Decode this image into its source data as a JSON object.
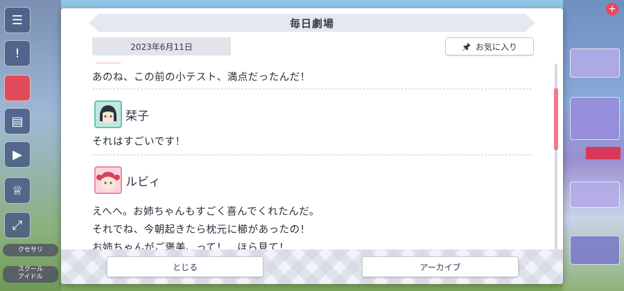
{
  "dialog": {
    "title": "毎日劇場",
    "date": "2023年6月11日",
    "favorite_label": "お気に入り",
    "close_label": "とじる",
    "archive_label": "アーカイブ"
  },
  "conversation": {
    "previous_line": "あのね、この前の小テスト、満点だったんだ！",
    "entries": [
      {
        "speaker": "栞子",
        "avatar": "shioriko-avatar",
        "lines": [
          "それはすごいです！"
        ]
      },
      {
        "speaker": "ルビィ",
        "avatar": "ruby-avatar",
        "lines": [
          "えへへ。お姉ちゃんもすごく喜んでくれたんだ。",
          "それでね、今朝起きたら枕元に櫛があったの！",
          "お姉ちゃんがご褒美、って！　ほら見て！"
        ]
      }
    ]
  },
  "background": {
    "left_labels": [
      "クセサリ",
      "スクール\nアイドル"
    ]
  },
  "colors": {
    "accent": "#f07a8a",
    "title_bar": "#e6e8f0",
    "text": "#2a2d3a"
  }
}
